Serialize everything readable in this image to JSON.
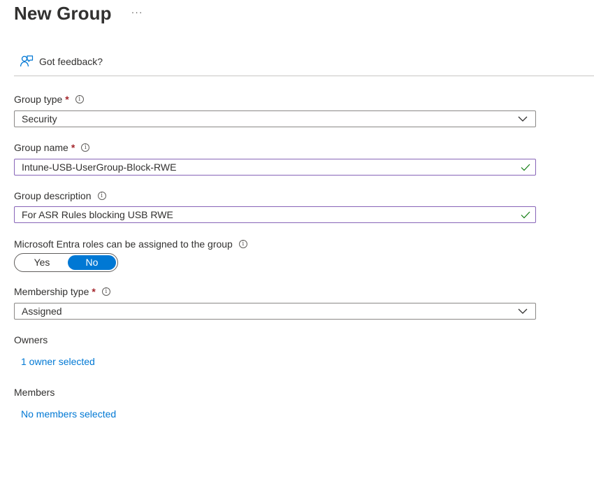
{
  "header": {
    "title": "New Group",
    "more_label": "···"
  },
  "toolbar": {
    "feedback_label": "Got feedback?",
    "feedback_icon": "feedback-person-icon"
  },
  "form": {
    "group_type": {
      "label": "Group type",
      "required": "*",
      "value": "Security"
    },
    "group_name": {
      "label": "Group name",
      "required": "*",
      "value": "Intune-USB-UserGroup-Block-RWE"
    },
    "group_description": {
      "label": "Group description",
      "value": "For ASR Rules blocking USB RWE"
    },
    "entra_roles": {
      "label": "Microsoft Entra roles can be assigned to the group",
      "yes_label": "Yes",
      "no_label": "No",
      "selected": "No"
    },
    "membership_type": {
      "label": "Membership type",
      "required": "*",
      "value": "Assigned"
    },
    "owners": {
      "label": "Owners",
      "link": "1 owner selected"
    },
    "members": {
      "label": "Members",
      "link": "No members selected"
    }
  },
  "colors": {
    "accent": "#0078d4",
    "required": "#a4262c",
    "valid_check": "#107c10",
    "focus_border": "#8764b8"
  }
}
